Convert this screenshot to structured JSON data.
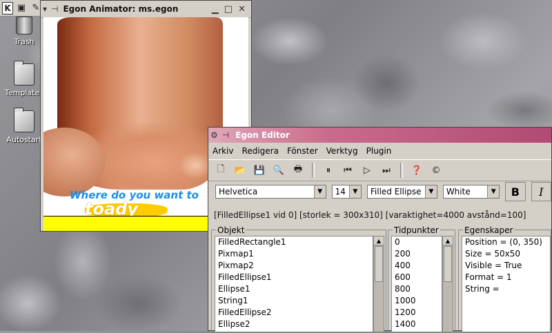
{
  "desktop": {
    "icons": [
      {
        "label": "Trash"
      },
      {
        "label": "Templates"
      },
      {
        "label": "Autostart"
      }
    ]
  },
  "animator": {
    "title": "Egon Animator: ms.egon",
    "canvas": {
      "slogan": "Where do you want to",
      "brand": "toady"
    }
  },
  "editor": {
    "title": "Egon Editor",
    "menu": [
      "Arkiv",
      "Redigera",
      "Fönster",
      "Verktyg",
      "Plugin"
    ],
    "font": {
      "family": "Helvetica",
      "size": "14",
      "shape": "Filled Ellipse",
      "color": "White",
      "bold": "B",
      "italic": "I"
    },
    "status": "[FilledEllipse1 vid 0] [storlek = 300x310] [varaktighet=4000 avstånd=100]",
    "objekt": {
      "label": "Objekt",
      "items": [
        "FilledRectangle1",
        "Pixmap1",
        "Pixmap2",
        "FilledEllipse1",
        "Ellipse1",
        "String1",
        "FilledEllipse2",
        "Ellipse2"
      ]
    },
    "tidpunkter": {
      "label": "Tidpunkter",
      "items": [
        "0",
        "200",
        "400",
        "600",
        "800",
        "1000",
        "1200",
        "1400"
      ]
    },
    "egenskaper": {
      "label": "Egenskaper",
      "items": [
        "Position = (0, 350)",
        "Size = 50x50",
        "Visible = True",
        "Format = 1",
        "String ="
      ]
    }
  }
}
